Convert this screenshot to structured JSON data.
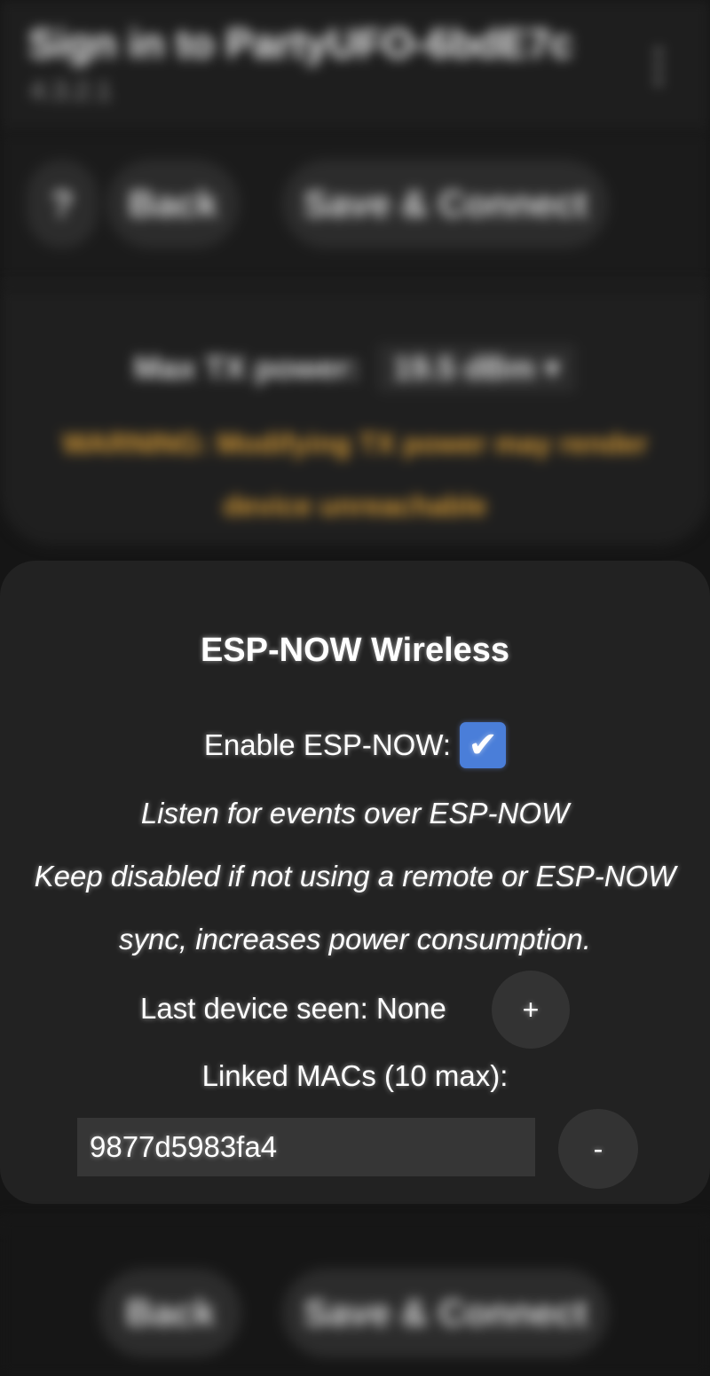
{
  "header": {
    "title": "Sign in to PartyUFO-6bdE7c",
    "subtitle": "4.3.2.1",
    "menu_icon": "more-vert-icon"
  },
  "top_nav": {
    "help_label": "?",
    "back_label": "Back",
    "save_label": "Save & Connect"
  },
  "tx_power": {
    "label": "Max TX power:",
    "selected": "19.5 dBm",
    "warning": "WARNING: Modifying TX power may render device unreachable"
  },
  "esp_now": {
    "title": "ESP-NOW Wireless",
    "enable_label": "Enable ESP-NOW:",
    "enabled": true,
    "desc_line1": "Listen for events over ESP-NOW",
    "desc_line2": "Keep disabled if not using a remote or ESP-NOW",
    "desc_line3": "sync, increases power consumption.",
    "last_device_label": "Last device seen: None",
    "add_label": "+",
    "linked_label": "Linked MACs (10 max):",
    "mac_value": "9877d5983fa4",
    "remove_label": "-"
  },
  "footer_nav": {
    "back_label": "Back",
    "save_label": "Save & Connect"
  },
  "colors": {
    "background": "#151515",
    "card": "#222222",
    "checkbox": "#4a7ed9",
    "warning": "#d59a35"
  }
}
